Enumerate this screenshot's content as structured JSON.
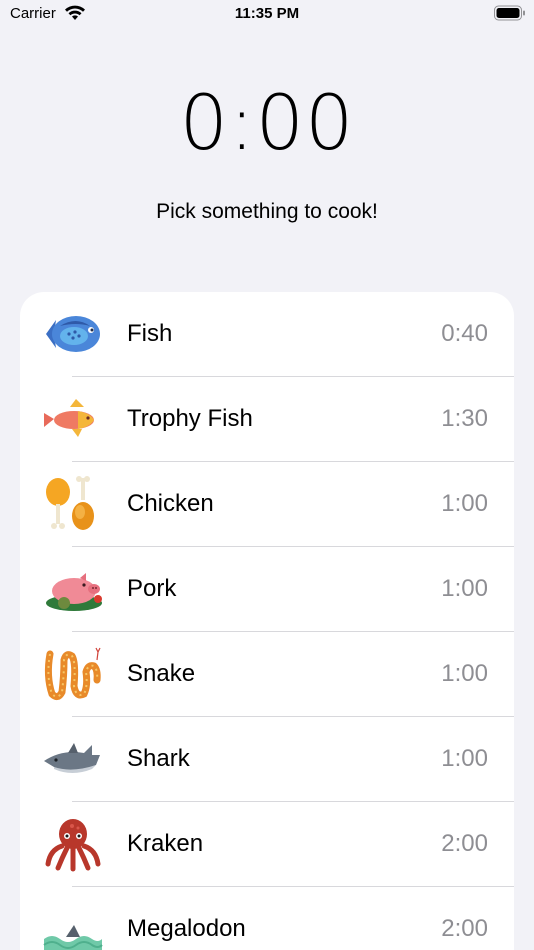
{
  "status_bar": {
    "carrier": "Carrier",
    "time": "11:35 PM"
  },
  "timer": {
    "display": "0:00",
    "prompt": "Pick something to cook!"
  },
  "items": [
    {
      "name": "Fish",
      "time": "0:40",
      "icon": "fish-icon"
    },
    {
      "name": "Trophy Fish",
      "time": "1:30",
      "icon": "trophy-fish-icon"
    },
    {
      "name": "Chicken",
      "time": "1:00",
      "icon": "chicken-icon"
    },
    {
      "name": "Pork",
      "time": "1:00",
      "icon": "pork-icon"
    },
    {
      "name": "Snake",
      "time": "1:00",
      "icon": "snake-icon"
    },
    {
      "name": "Shark",
      "time": "1:00",
      "icon": "shark-icon"
    },
    {
      "name": "Kraken",
      "time": "2:00",
      "icon": "kraken-icon"
    },
    {
      "name": "Megalodon",
      "time": "2:00",
      "icon": "megalodon-icon"
    }
  ],
  "colors": {
    "background": "#f2f2f7",
    "card": "#ffffff",
    "secondary_text": "#8e8e93",
    "separator": "#d8d8dc"
  }
}
